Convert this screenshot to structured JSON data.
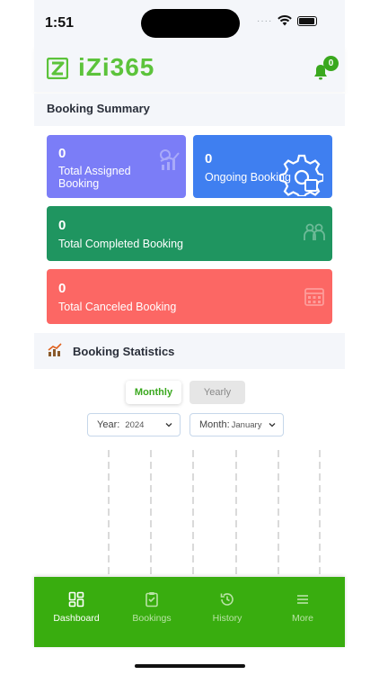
{
  "status": {
    "time": "1:51",
    "dots": "····"
  },
  "brand": {
    "name": "iZi365",
    "color": "#5cc33b"
  },
  "notifications": {
    "count": "0"
  },
  "summary": {
    "title": "Booking Summary"
  },
  "cards": [
    {
      "value": "0",
      "label": "Total Assigned Booking",
      "color": "#7b7df7",
      "icon": "chart-icon"
    },
    {
      "value": "0",
      "label": "Ongoing Booking",
      "color": "#3f7ff0",
      "icon": "gear-icon"
    },
    {
      "value": "0",
      "label": "Total Completed Booking",
      "color": "#1f9560",
      "icon": "users-icon"
    },
    {
      "value": "0",
      "label": "Total Canceled Booking",
      "color": "#fc6764",
      "icon": "calendar-icon"
    }
  ],
  "stats": {
    "title": "Booking Statistics",
    "tabs": {
      "monthly": "Monthly",
      "yearly": "Yearly",
      "active": "Monthly"
    },
    "year": {
      "label": "Year:",
      "value": "2024"
    },
    "month": {
      "label": "Month:",
      "value": "January"
    }
  },
  "nav": [
    {
      "label": "Dashboard",
      "icon": "dashboard-icon",
      "active": true
    },
    {
      "label": "Bookings",
      "icon": "clipboard-icon",
      "active": false
    },
    {
      "label": "History",
      "icon": "history-icon",
      "active": false
    },
    {
      "label": "More",
      "icon": "menu-icon",
      "active": false
    }
  ],
  "colors": {
    "accent": "#39ad0f",
    "background": "#f4f6fa"
  }
}
